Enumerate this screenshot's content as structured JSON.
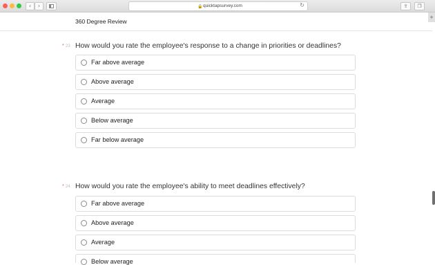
{
  "browser": {
    "url_host": "quicktapsurvey.com",
    "lock_icon": "lock-icon",
    "reload_icon": "reload-icon"
  },
  "page": {
    "survey_title": "360 Degree Review"
  },
  "questions": [
    {
      "number": "23",
      "required_mark": "*",
      "text": "How would you rate the employee's response to a change in priorities or deadlines?",
      "options": [
        "Far above average",
        "Above average",
        "Average",
        "Below average",
        "Far below average"
      ]
    },
    {
      "number": "24",
      "required_mark": "*",
      "text": "How would you rate the employee's ability to meet deadlines effectively?",
      "options": [
        "Far above average",
        "Above average",
        "Average",
        "Below average"
      ]
    }
  ]
}
